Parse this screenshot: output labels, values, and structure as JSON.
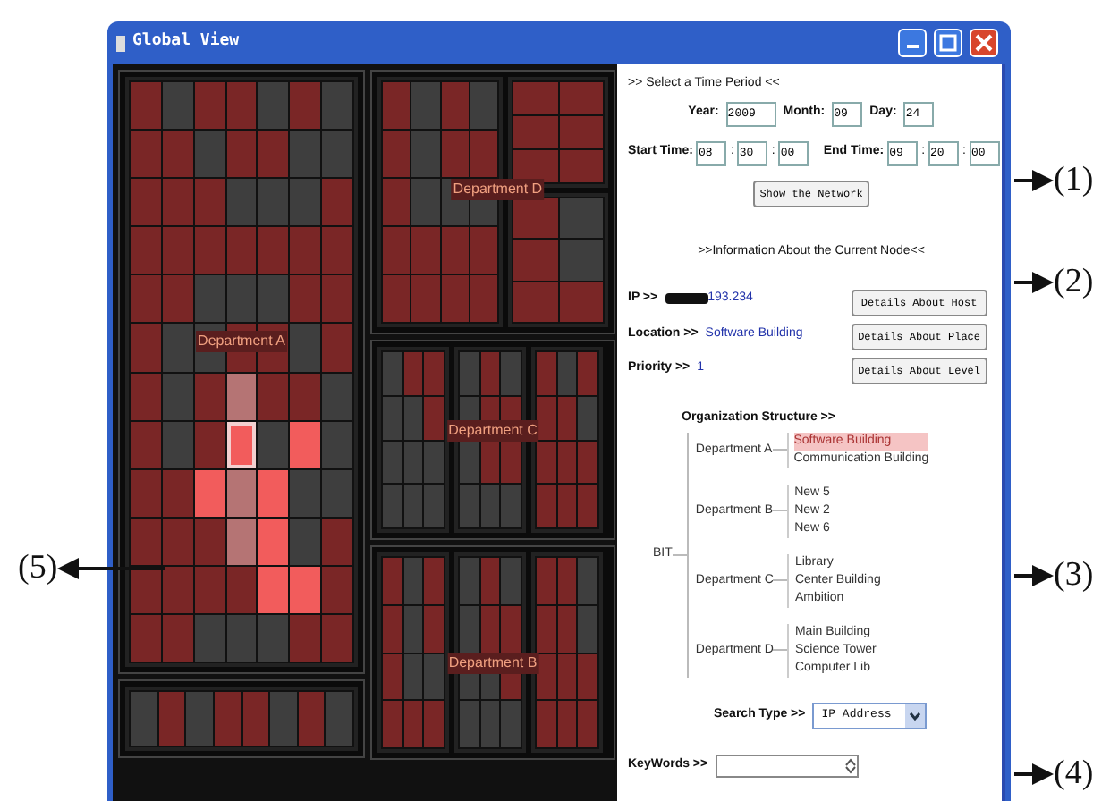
{
  "window": {
    "title": "Global View"
  },
  "treemap": {
    "departments": [
      {
        "label": "Department A"
      },
      {
        "label": "Department D"
      },
      {
        "label": "Department C"
      },
      {
        "label": "Department B"
      }
    ]
  },
  "time_period": {
    "heading": ">> Select a Time Period <<",
    "year_label": "Year:",
    "year": "2009",
    "month_label": "Month:",
    "month": "09",
    "day_label": "Day:",
    "day": "24",
    "start_label": "Start Time:",
    "start": [
      "08",
      "30",
      "00"
    ],
    "end_label": "End Time:",
    "end": [
      "09",
      "20",
      "00"
    ],
    "separator": ":",
    "button": "Show the Network"
  },
  "node_info": {
    "heading": ">>Information About the Current Node<<",
    "ip_label": "IP >>",
    "ip_value": "193.234",
    "location_label": "Location >>",
    "location_value": "Software Building",
    "priority_label": "Priority >>",
    "priority_value": "1",
    "buttons": [
      "Details About Host",
      "Details About Place",
      "Details About Level"
    ]
  },
  "organization": {
    "heading": "Organization Structure >>",
    "tree": {
      "label": "BIT",
      "children": [
        {
          "label": "Department A",
          "children": [
            {
              "label": "Software Building",
              "selected": true
            },
            {
              "label": "Communication Building",
              "selected": false
            }
          ]
        },
        {
          "label": "Department B",
          "children": [
            {
              "label": "New 5",
              "selected": false
            },
            {
              "label": "New 2",
              "selected": false
            },
            {
              "label": "New 6",
              "selected": false
            }
          ]
        },
        {
          "label": "Department C",
          "children": [
            {
              "label": "Library",
              "selected": false
            },
            {
              "label": "Center Building",
              "selected": false
            },
            {
              "label": "Ambition",
              "selected": false
            }
          ]
        },
        {
          "label": "Department D",
          "children": [
            {
              "label": "Main Building",
              "selected": false
            },
            {
              "label": "Science Tower",
              "selected": false
            },
            {
              "label": "Computer Lib",
              "selected": false
            }
          ]
        }
      ]
    }
  },
  "search": {
    "type_label": "Search Type >>",
    "type_value": "IP Address",
    "keywords_label": "KeyWords >>"
  },
  "annotations": [
    {
      "label": "(1)",
      "kind": "right"
    },
    {
      "label": "(2)",
      "kind": "right"
    },
    {
      "label": "(5)",
      "kind": "left"
    },
    {
      "label": "(3)",
      "kind": "right"
    },
    {
      "label": "(4)",
      "kind": "right"
    }
  ]
}
